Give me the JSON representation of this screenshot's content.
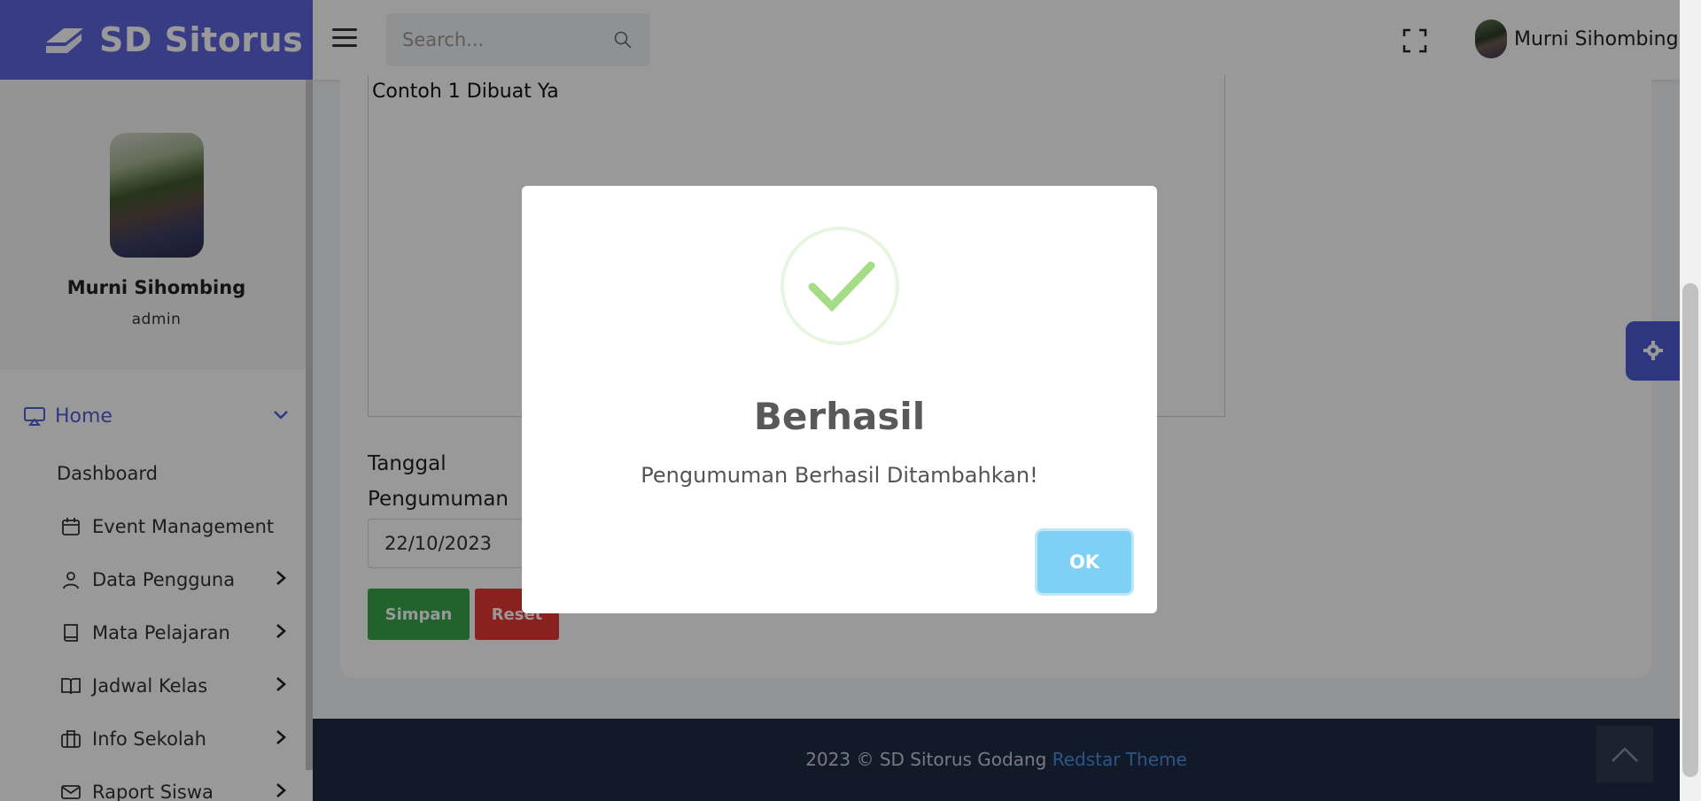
{
  "brand": {
    "title": "SD Sitorus"
  },
  "header": {
    "search_placeholder": "Search...",
    "user_name": "Murni Sihombing"
  },
  "sidebar": {
    "profile_name": "Murni Sihombing",
    "profile_role": "admin",
    "home_label": "Home",
    "dashboard_label": "Dashboard",
    "items": [
      {
        "label": "Event Management",
        "icon": "calendar-icon"
      },
      {
        "label": "Data Pengguna",
        "icon": "user-icon"
      },
      {
        "label": "Mata Pelajaran",
        "icon": "book-icon"
      },
      {
        "label": "Jadwal Kelas",
        "icon": "open-book-icon"
      },
      {
        "label": "Info Sekolah",
        "icon": "building-icon"
      },
      {
        "label": "Raport Siswa",
        "icon": "mail-icon"
      }
    ]
  },
  "form": {
    "textarea_value": "Contoh 1 Dibuat Ya",
    "date_label": "Tanggal Pengumuman",
    "date_value": "22/10/2023",
    "save_label": "Simpan",
    "reset_label": "Reset"
  },
  "footer": {
    "text": "2023 © SD Sitorus Godang",
    "link": "Redstar Theme"
  },
  "modal": {
    "title": "Berhasil",
    "message": "Pengumuman Berhasil Ditambahkan!",
    "ok_label": "OK"
  },
  "colors": {
    "brand": "#5d64dd",
    "save": "#3aa34c",
    "reset": "#e53935",
    "ok": "#7fd0f5",
    "footer": "#1e2a44"
  }
}
